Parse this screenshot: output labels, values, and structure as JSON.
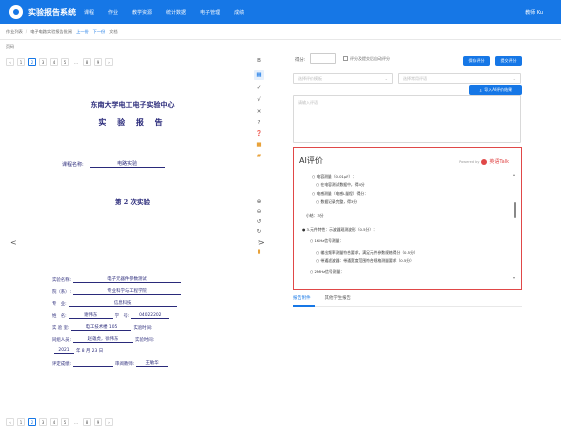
{
  "app": {
    "title": "实验报告系统",
    "user": "教师 Ku"
  },
  "nav": [
    "课程",
    "作业",
    "教学资源",
    "统计数据",
    "电子管理",
    "成绩"
  ],
  "subbar": {
    "crumbs": [
      "作业列表",
      "电子电路实验报告批阅"
    ],
    "prev": "上一份",
    "next": "下一份",
    "extra": "文档"
  },
  "pager_top": {
    "label": "页码",
    "pages": [
      "1",
      "2",
      "3",
      "4",
      "5",
      "…",
      "8",
      "9"
    ],
    "active": "2"
  },
  "pager_bottom": {
    "pages": [
      "1",
      "2",
      "3",
      "4",
      "5",
      "…",
      "8",
      "9"
    ],
    "active": "2"
  },
  "doc": {
    "h1": "东南大学电工电子实验中心",
    "h2": "实 验 报 告",
    "course_label": "课程名称:",
    "course_value": "电路实验",
    "h3": "第 2 次实验",
    "rows": [
      {
        "label": "实验名称:",
        "value": "电子元器件参数测试"
      },
      {
        "label": "院（系）:",
        "value": "专业科学与工程学院"
      },
      {
        "label": "专　业:",
        "value": "信息科技"
      },
      {
        "label": "姓　名:",
        "value": "谢伟东",
        "label2": "学　号:",
        "value2": "04022202"
      },
      {
        "label": "实 验 室:",
        "value": "电工技术楼 105",
        "label2": "实验时间:",
        "value2": ""
      },
      {
        "label": "同组人员:",
        "value": "赵雄虎，徐伟东",
        "label2": "实验时间:",
        "value2": ""
      },
      {
        "label": "2021",
        "value": "年 8 月 23 日",
        "label2": "",
        "value2": ""
      },
      {
        "label": "评定成绩:",
        "value": "",
        "label2": "审阅教师:",
        "value2": "王敏华"
      }
    ]
  },
  "right": {
    "score_label": "得分:",
    "checkbox_label": "评分及提交后自动评分",
    "btn_save": "保存评分",
    "btn_submit": "提交评分",
    "select1": "选择评价模板",
    "select2": "选择常用评语",
    "btn_ai": "导入AI评价结果",
    "textarea_placeholder": "请输入评语",
    "ai_title": "AI评价",
    "powered_by": "Powered by",
    "powered_name": "英语Talk",
    "ai_lines": [
      "○ 电容测量（0.01μF）：",
      "○ 在电容测试数据中，得4分",
      "○ 电感测量（电感L量程）得分：",
      "○ 数据记录完整，得3分",
      "小结：3分",
      "● 3.元件特性：示波器观测波形（0.5分）：",
      "○ 1KHz信号测量：",
      "○ 输出频率测量符合要求，满足元件参数规格得分（0.5分）",
      "○ 带通滤波器：带通宽度范围符合规格测量要求（0.5分）",
      "○ 2MHz信号测量："
    ],
    "tab_active": "报告附件",
    "tab2": "其他学生报告"
  }
}
